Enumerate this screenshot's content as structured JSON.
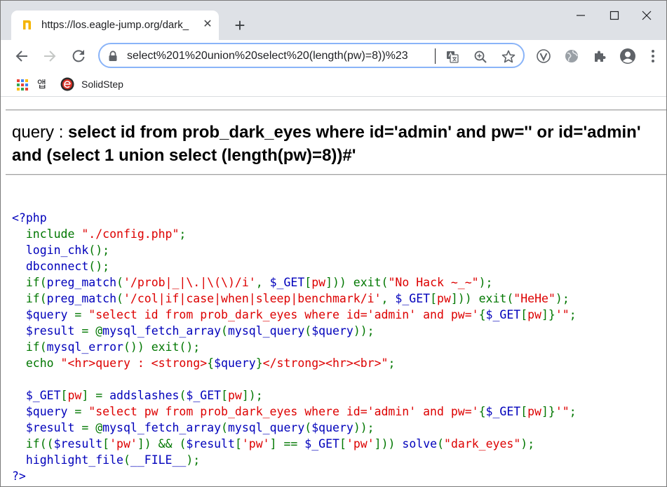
{
  "browser": {
    "tab_title": "https://los.eagle-jump.org/dark_",
    "tab_close": "✕",
    "new_tab": "+",
    "url": "select%201%20union%20select%20(length(pw)=8))%23",
    "bookmarks": [
      {
        "label": "앱",
        "icon": "apps-grid-icon"
      },
      {
        "label": "SolidStep",
        "icon": "solidstep-logo-icon"
      }
    ],
    "colors": {
      "tabstrip": "#dee1e6",
      "omnibox_focus": "#8ab4f8"
    }
  },
  "page": {
    "query_label": "query : ",
    "query_strong": "select id from prob_dark_eyes where id='admin' and pw='' or id='admin' and (select 1 union select (length(pw)=8))#'",
    "code_lines": [
      [
        {
          "c": "d",
          "t": "<?php"
        }
      ],
      [
        {
          "c": "k",
          "t": "  include "
        },
        {
          "c": "s",
          "t": "\"./config.php\""
        },
        {
          "c": "k",
          "t": ";"
        }
      ],
      [
        {
          "c": "d",
          "t": "  login_chk"
        },
        {
          "c": "k",
          "t": "();"
        }
      ],
      [
        {
          "c": "d",
          "t": "  dbconnect"
        },
        {
          "c": "k",
          "t": "();"
        }
      ],
      [
        {
          "c": "k",
          "t": "  if("
        },
        {
          "c": "d",
          "t": "preg_match"
        },
        {
          "c": "k",
          "t": "("
        },
        {
          "c": "s",
          "t": "'/prob|_|\\.|\\(\\)/i'"
        },
        {
          "c": "k",
          "t": ", "
        },
        {
          "c": "d",
          "t": "$_GET"
        },
        {
          "c": "k",
          "t": "["
        },
        {
          "c": "s",
          "t": "pw"
        },
        {
          "c": "k",
          "t": "])) exit("
        },
        {
          "c": "s",
          "t": "\"No Hack ~_~\""
        },
        {
          "c": "k",
          "t": ");"
        }
      ],
      [
        {
          "c": "k",
          "t": "  if("
        },
        {
          "c": "d",
          "t": "preg_match"
        },
        {
          "c": "k",
          "t": "("
        },
        {
          "c": "s",
          "t": "'/col|if|case|when|sleep|benchmark/i'"
        },
        {
          "c": "k",
          "t": ", "
        },
        {
          "c": "d",
          "t": "$_GET"
        },
        {
          "c": "k",
          "t": "["
        },
        {
          "c": "s",
          "t": "pw"
        },
        {
          "c": "k",
          "t": "])) exit("
        },
        {
          "c": "s",
          "t": "\"HeHe\""
        },
        {
          "c": "k",
          "t": ");"
        }
      ],
      [
        {
          "c": "d",
          "t": "  $query "
        },
        {
          "c": "k",
          "t": "= "
        },
        {
          "c": "s",
          "t": "\"select id from prob_dark_eyes where id='admin' and pw='"
        },
        {
          "c": "k",
          "t": "{"
        },
        {
          "c": "d",
          "t": "$_GET"
        },
        {
          "c": "k",
          "t": "["
        },
        {
          "c": "s",
          "t": "pw"
        },
        {
          "c": "k",
          "t": "]}"
        },
        {
          "c": "s",
          "t": "'\""
        },
        {
          "c": "k",
          "t": ";"
        }
      ],
      [
        {
          "c": "d",
          "t": "  $result "
        },
        {
          "c": "k",
          "t": "= @"
        },
        {
          "c": "d",
          "t": "mysql_fetch_array"
        },
        {
          "c": "k",
          "t": "("
        },
        {
          "c": "d",
          "t": "mysql_query"
        },
        {
          "c": "k",
          "t": "("
        },
        {
          "c": "d",
          "t": "$query"
        },
        {
          "c": "k",
          "t": "));"
        }
      ],
      [
        {
          "c": "k",
          "t": "  if("
        },
        {
          "c": "d",
          "t": "mysql_error"
        },
        {
          "c": "k",
          "t": "()) exit();"
        }
      ],
      [
        {
          "c": "k",
          "t": "  echo "
        },
        {
          "c": "s",
          "t": "\"<hr>query : <strong>"
        },
        {
          "c": "k",
          "t": "{"
        },
        {
          "c": "d",
          "t": "$query"
        },
        {
          "c": "k",
          "t": "}"
        },
        {
          "c": "s",
          "t": "</strong><hr><br>\""
        },
        {
          "c": "k",
          "t": ";"
        }
      ],
      [
        {
          "c": "d",
          "t": ""
        }
      ],
      [
        {
          "c": "d",
          "t": "  $_GET"
        },
        {
          "c": "k",
          "t": "["
        },
        {
          "c": "s",
          "t": "pw"
        },
        {
          "c": "k",
          "t": "] = "
        },
        {
          "c": "d",
          "t": "addslashes"
        },
        {
          "c": "k",
          "t": "("
        },
        {
          "c": "d",
          "t": "$_GET"
        },
        {
          "c": "k",
          "t": "["
        },
        {
          "c": "s",
          "t": "pw"
        },
        {
          "c": "k",
          "t": "]);"
        }
      ],
      [
        {
          "c": "d",
          "t": "  $query "
        },
        {
          "c": "k",
          "t": "= "
        },
        {
          "c": "s",
          "t": "\"select pw from prob_dark_eyes where id='admin' and pw='"
        },
        {
          "c": "k",
          "t": "{"
        },
        {
          "c": "d",
          "t": "$_GET"
        },
        {
          "c": "k",
          "t": "["
        },
        {
          "c": "s",
          "t": "pw"
        },
        {
          "c": "k",
          "t": "]}"
        },
        {
          "c": "s",
          "t": "'\""
        },
        {
          "c": "k",
          "t": ";"
        }
      ],
      [
        {
          "c": "d",
          "t": "  $result "
        },
        {
          "c": "k",
          "t": "= @"
        },
        {
          "c": "d",
          "t": "mysql_fetch_array"
        },
        {
          "c": "k",
          "t": "("
        },
        {
          "c": "d",
          "t": "mysql_query"
        },
        {
          "c": "k",
          "t": "("
        },
        {
          "c": "d",
          "t": "$query"
        },
        {
          "c": "k",
          "t": "));"
        }
      ],
      [
        {
          "c": "k",
          "t": "  if(("
        },
        {
          "c": "d",
          "t": "$result"
        },
        {
          "c": "k",
          "t": "["
        },
        {
          "c": "s",
          "t": "'pw'"
        },
        {
          "c": "k",
          "t": "]) && ("
        },
        {
          "c": "d",
          "t": "$result"
        },
        {
          "c": "k",
          "t": "["
        },
        {
          "c": "s",
          "t": "'pw'"
        },
        {
          "c": "k",
          "t": "] == "
        },
        {
          "c": "d",
          "t": "$_GET"
        },
        {
          "c": "k",
          "t": "["
        },
        {
          "c": "s",
          "t": "'pw'"
        },
        {
          "c": "k",
          "t": "])) "
        },
        {
          "c": "d",
          "t": "solve"
        },
        {
          "c": "k",
          "t": "("
        },
        {
          "c": "s",
          "t": "\"dark_eyes\""
        },
        {
          "c": "k",
          "t": ");"
        }
      ],
      [
        {
          "c": "d",
          "t": "  highlight_file"
        },
        {
          "c": "k",
          "t": "("
        },
        {
          "c": "d",
          "t": "__FILE__"
        },
        {
          "c": "k",
          "t": ");"
        }
      ],
      [
        {
          "c": "d",
          "t": "?>"
        }
      ]
    ]
  }
}
